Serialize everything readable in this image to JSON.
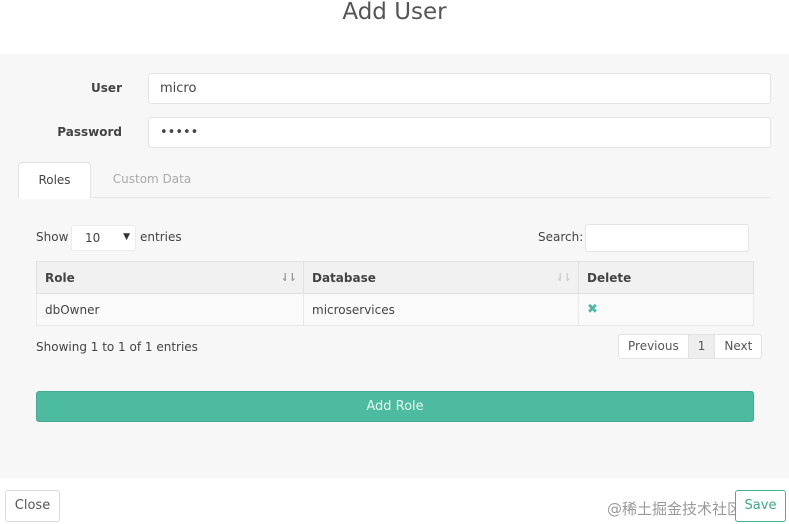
{
  "header": {
    "title": "Add User"
  },
  "form": {
    "user_label": "User",
    "user_value": "micro",
    "password_label": "Password",
    "password_value": "•••••"
  },
  "tabs": [
    {
      "label": "Roles",
      "active": true
    },
    {
      "label": "Custom Data",
      "active": false
    }
  ],
  "table_controls": {
    "show_label": "Show",
    "entries_value": "10",
    "entries_label": "entries",
    "search_label": "Search:",
    "search_value": ""
  },
  "table": {
    "columns": [
      "Role",
      "Database",
      "Delete"
    ],
    "rows": [
      {
        "role": "dbOwner",
        "database": "microservices",
        "delete_icon": "✖"
      }
    ],
    "sort_icon": "⇃⇂",
    "info": "Showing 1 to 1 of 1 entries"
  },
  "pagination": {
    "previous": "Previous",
    "current": "1",
    "next": "Next"
  },
  "buttons": {
    "add_role": "Add Role",
    "close": "Close",
    "save": "Save"
  },
  "watermark": "@稀土掘金技术社区",
  "colors": {
    "accent": "#4dbb9f",
    "delete_icon": "#4db99e"
  }
}
